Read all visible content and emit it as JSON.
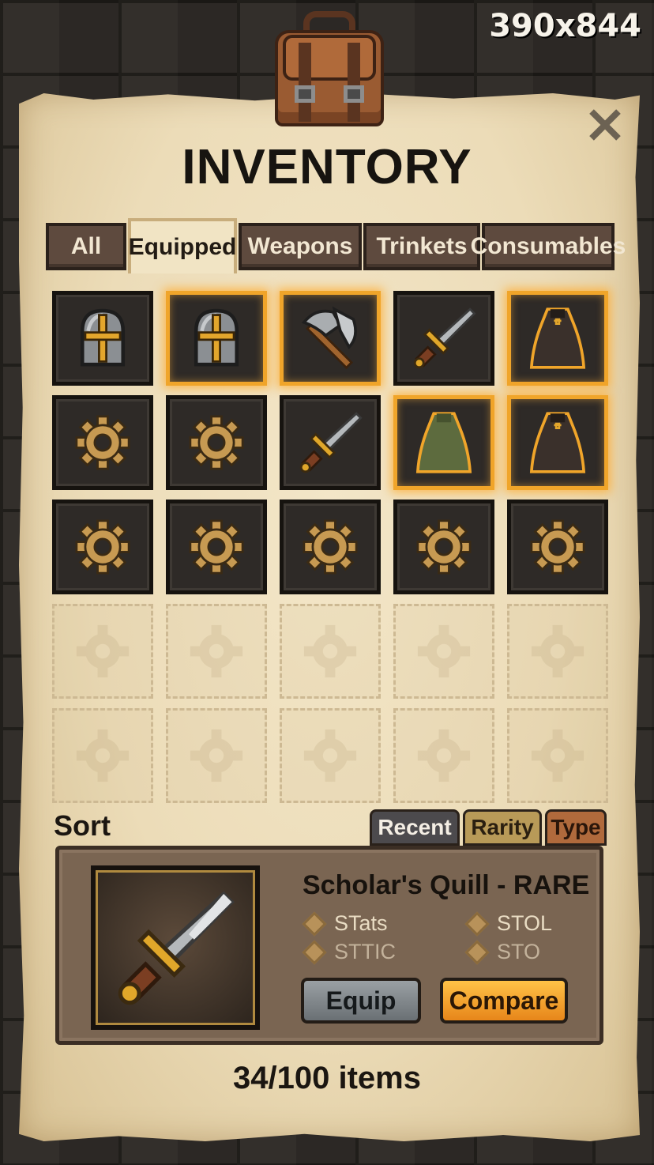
{
  "resolution_label": "390x844",
  "title": "INVENTORY",
  "tabs": [
    {
      "label": "All",
      "active": false
    },
    {
      "label": "Equipped",
      "active": true
    },
    {
      "label": "Weapons",
      "active": false
    },
    {
      "label": "Trinkets",
      "active": false
    },
    {
      "label": "Consumables",
      "active": false
    }
  ],
  "grid_rows": [
    [
      {
        "item": "helmet-icon",
        "highlighted": false
      },
      {
        "item": "helmet-icon",
        "highlighted": true
      },
      {
        "item": "axe-icon",
        "highlighted": true
      },
      {
        "item": "sword-icon",
        "highlighted": false
      },
      {
        "item": "dark-cloak-icon",
        "highlighted": true
      }
    ],
    [
      {
        "item": "gear-icon",
        "highlighted": false
      },
      {
        "item": "gear-icon",
        "highlighted": false
      },
      {
        "item": "sword-icon",
        "highlighted": false
      },
      {
        "item": "green-cloak-icon",
        "highlighted": true
      },
      {
        "item": "dark-cloak-icon",
        "highlighted": true
      }
    ],
    [
      {
        "item": "gear-icon",
        "highlighted": false
      },
      {
        "item": "gear-icon",
        "highlighted": false
      },
      {
        "item": "gear-icon",
        "highlighted": false
      },
      {
        "item": "gear-icon",
        "highlighted": false
      },
      {
        "item": "gear-icon",
        "highlighted": false
      }
    ],
    [
      {
        "item": "empty",
        "highlighted": false
      },
      {
        "item": "empty",
        "highlighted": false
      },
      {
        "item": "empty",
        "highlighted": false
      },
      {
        "item": "empty",
        "highlighted": false
      },
      {
        "item": "empty",
        "highlighted": false
      }
    ],
    [
      {
        "item": "empty",
        "highlighted": false
      },
      {
        "item": "empty",
        "highlighted": false
      },
      {
        "item": "empty",
        "highlighted": false
      },
      {
        "item": "empty",
        "highlighted": false
      },
      {
        "item": "empty",
        "highlighted": false
      }
    ]
  ],
  "sort": {
    "label": "Sort",
    "options": [
      {
        "label": "Recent",
        "color": "#4c4a4d",
        "text_color": "#f4eee4"
      },
      {
        "label": "Rarity",
        "color": "#b89a58",
        "text_color": "#2a1f10"
      },
      {
        "label": "Type",
        "color": "#b06a3c",
        "text_color": "#2a160a"
      }
    ]
  },
  "selected_item": {
    "name": "Scholar's Quill - RARE",
    "icon": "sword-icon",
    "stats": [
      "STats",
      "STOL",
      "STTIC",
      "STO"
    ],
    "equip_label": "Equip",
    "compare_label": "Compare"
  },
  "item_count": "34/100 items",
  "colors": {
    "highlight": "#f0a52a",
    "parchment": "#ecdcb8",
    "slot": "#2e2a27"
  }
}
